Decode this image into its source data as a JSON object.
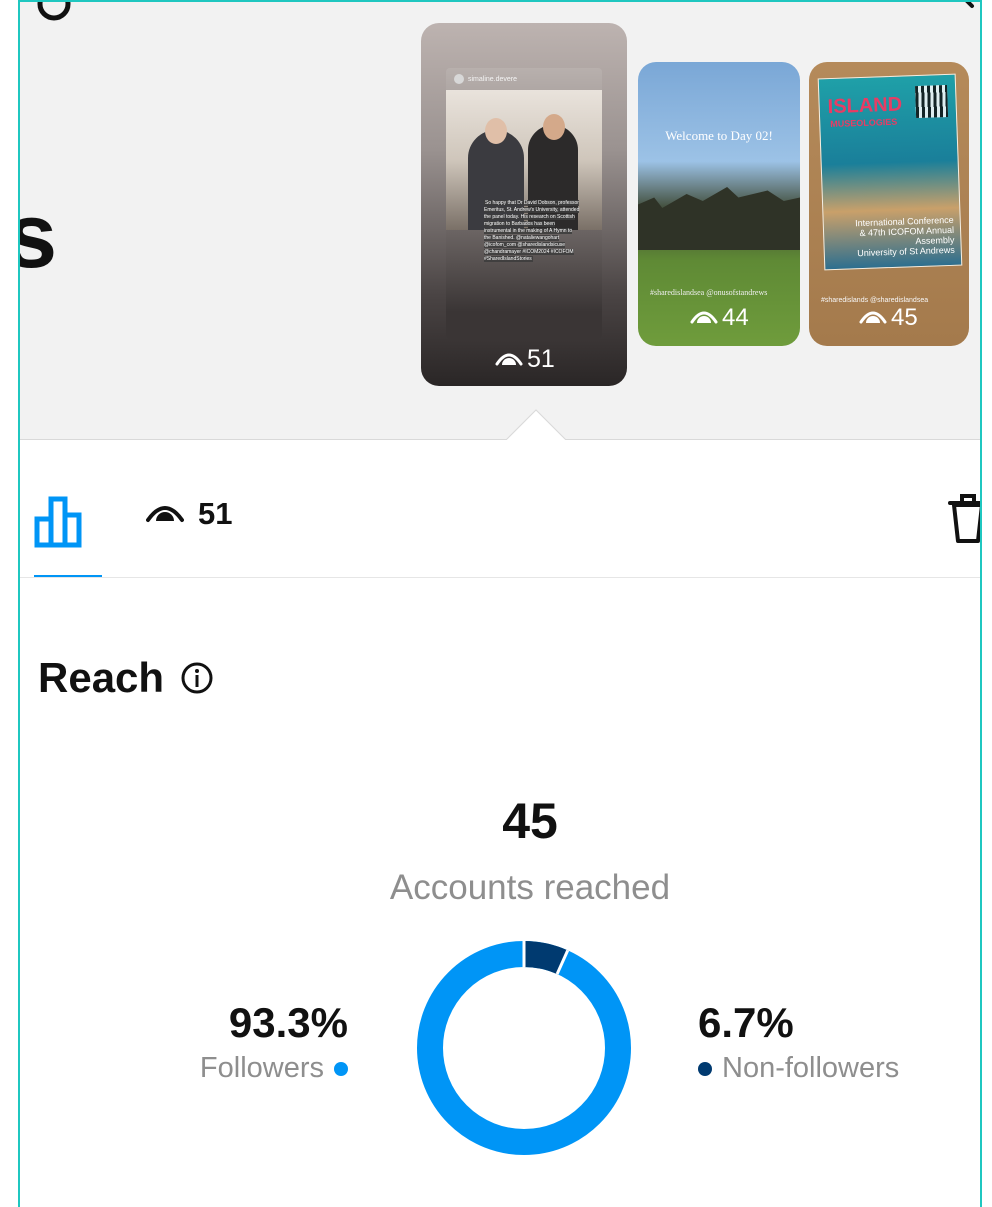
{
  "colors": {
    "accent": "#0095f6",
    "followers": "#0095f6",
    "non_followers": "#003a70",
    "secondary_text": "#8e8e8e"
  },
  "stories": [
    {
      "username": "simaline.devere",
      "caption": "So happy that Dr David Dobson, professor Emeritus, St. Andrew's University, attended the panel today. His research on Scottish migration to Barbados has been instrumental in the making of A Hymn to the Banished. @nataliewangohart @icofom_com @sharedislandsicuse @chandramayer #ICOM2024 #ICOFOM #SharedIslandStories",
      "views": "51",
      "selected": true
    },
    {
      "text": "Welcome to Day 02!",
      "tags": "#sharedislandsea @onusofstandrews",
      "views": "44",
      "selected": false
    },
    {
      "poster_title": "ISLAND",
      "poster_subtitle": "MUSEOLOGIES",
      "conference_title": "International Conference",
      "conference_detail": "& 47th ICOFOM Annual Assembly",
      "conference_host": "University of St Andrews",
      "tags": "#sharedislands @sharedislandsea",
      "views": "45",
      "selected": false
    }
  ],
  "left_fragment": "s",
  "toolbar": {
    "views": "51",
    "icons": [
      "bar-chart-icon",
      "eye-icon",
      "trash-icon"
    ]
  },
  "reach": {
    "title": "Reach",
    "count": "45",
    "caption": "Accounts reached",
    "followers": {
      "percent_label": "93.3%",
      "label": "Followers",
      "value": 93.3
    },
    "non_followers": {
      "percent_label": "6.7%",
      "label": "Non-followers",
      "value": 6.7
    }
  }
}
